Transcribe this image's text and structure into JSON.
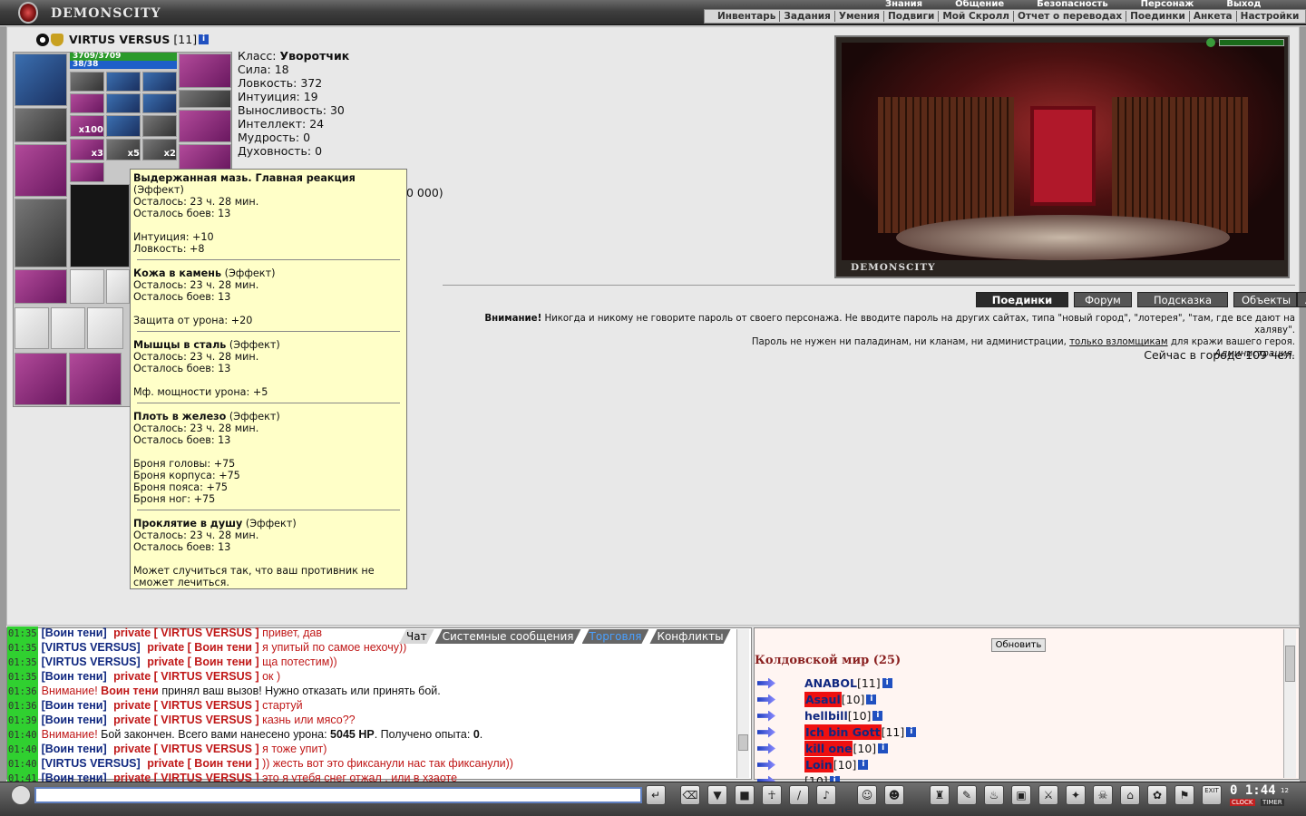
{
  "app": {
    "logo_text": "DEMONSCITY"
  },
  "main_menu": [
    "Знания",
    "Общение",
    "Безопасность",
    "Персонаж",
    "Выход"
  ],
  "sub_menu": [
    "Инвентарь",
    "Задания",
    "Умения",
    "Подвиги",
    "Мой Скролл",
    "Отчет о переводах",
    "Поединки",
    "Анкета",
    "Настройки"
  ],
  "character": {
    "name": "VIRTUS VERSUS",
    "level": "[11]",
    "hp": "3709/3709",
    "mp": "38/38",
    "hp_fraction": 1.0,
    "mp_fraction": 1.0
  },
  "stats": [
    {
      "label": "Класс:",
      "value": "Уворотчик",
      "bold": true
    },
    {
      "label": "Сила:",
      "value": "18"
    },
    {
      "label": "Ловкость:",
      "value": "372"
    },
    {
      "label": "Интуиция:",
      "value": "19"
    },
    {
      "label": "Выносливость:",
      "value": "30"
    },
    {
      "label": "Интеллект:",
      "value": "24"
    },
    {
      "label": "Мудрость:",
      "value": "0"
    },
    {
      "label": "Духовность:",
      "value": "0"
    }
  ],
  "partial_text": "0 000)",
  "slot_counts": {
    "a": "x100",
    "b": "x3",
    "c": "x5",
    "d": "x2"
  },
  "tooltip": {
    "effects": [
      {
        "title": "Выдержанная мазь. Главная реакция",
        "suffix": "",
        "type_line": "(Эффект)",
        "remain": "Осталось: 23 ч. 28 мин.",
        "fights": "Осталось боев: 13",
        "bonuses": [
          "Интуиция: +10",
          "Ловкость: +8"
        ]
      },
      {
        "title": "Кожа в камень",
        "suffix": " (Эффект)",
        "type_line": "",
        "remain": "Осталось: 23 ч. 28 мин.",
        "fights": "Осталось боев: 13",
        "bonuses": [
          "Защита от урона: +20"
        ]
      },
      {
        "title": "Мышцы в сталь",
        "suffix": " (Эффект)",
        "type_line": "",
        "remain": "Осталось: 23 ч. 28 мин.",
        "fights": "Осталось боев: 13",
        "bonuses": [
          "Мф. мощности урона: +5"
        ]
      },
      {
        "title": "Плоть в железо",
        "suffix": " (Эффект)",
        "type_line": "",
        "remain": "Осталось: 23 ч. 28 мин.",
        "fights": "Осталось боев: 13",
        "bonuses": [
          "Броня головы: +75",
          "Броня корпуса: +75",
          "Броня пояса: +75",
          "Броня ног: +75"
        ]
      },
      {
        "title": "Проклятие в душу",
        "suffix": " (Эффект)",
        "type_line": "",
        "remain": "Осталось: 23 ч. 28 мин.",
        "fights": "Осталось боев: 13",
        "bonuses": [
          "Может случиться так, что ваш противник не сможет лечиться."
        ]
      }
    ]
  },
  "location": {
    "title": "DEMONSCITY"
  },
  "tabs": [
    "Поединки",
    "Форум",
    "Подсказка",
    "Объекты",
    "Δ"
  ],
  "warning": {
    "bold": "Внимание!",
    "line1": " Никогда и никому не говорите пароль от своего персонажа. Не вводите пароль на других сайтах, типа \"новый город\", \"лотерея\", \"там, где все дают на халяву\".",
    "line2_pre": "Пароль не нужен ни паладинам, ни кланам, ни администрации, ",
    "line2_link": "только взломщикам",
    "line2_post": " для кражи вашего героя.",
    "signature": "Администрация."
  },
  "online": "Сейчас в городе 109 чел.",
  "chat_tabs": [
    "Чат",
    "Системные сообщения",
    "Торговля",
    "Конфликты"
  ],
  "chat": [
    {
      "time": "01:35",
      "from": "[Воин тени]",
      "priv": "private [ VIRTUS VERSUS ]",
      "msg": " привет, дав"
    },
    {
      "time": "01:35",
      "from": "[VIRTUS VERSUS]",
      "priv": "private [ Воин тени ]",
      "msg": " я упитый по самое нехочу))"
    },
    {
      "time": "01:35",
      "from": "[VIRTUS VERSUS]",
      "priv": "private [ Воин тени ]",
      "msg": " ща потестим))"
    },
    {
      "time": "01:35",
      "from": "[Воин тени]",
      "priv": "private [ VIRTUS VERSUS ]",
      "msg": " ок )"
    },
    {
      "time": "01:36",
      "sys": true,
      "parts": [
        "Внимание! ",
        "Воин тени",
        " принял ваш вызов! Нужно отказать или принять бой."
      ]
    },
    {
      "time": "01:36",
      "from": "[Воин тени]",
      "priv": "private [ VIRTUS VERSUS ]",
      "msg": " стартуй"
    },
    {
      "time": "01:39",
      "from": "[Воин тени]",
      "priv": "private [ VIRTUS VERSUS ]",
      "msg": " казнь или мясо??"
    },
    {
      "time": "01:40",
      "sys2": true,
      "parts": [
        "Внимание! ",
        "Бой закончен. Всего вами нанесено урона: ",
        "5045 HP",
        ". Получено опыта: ",
        "0",
        "."
      ]
    },
    {
      "time": "01:40",
      "from": "[Воин тени]",
      "priv": "private [ VIRTUS VERSUS ]",
      "msg": " я тоже упит)"
    },
    {
      "time": "01:40",
      "from": "[VIRTUS VERSUS]",
      "priv": "private [ Воин тени ]",
      "msg": " )) жесть вот это фиксанули нас так фиксанули))"
    },
    {
      "time": "01:41",
      "from": "[Воин тени]",
      "priv": "private [ VIRTUS VERSUS ]",
      "msg": " это я утебя снег отжал , или в хзаоте"
    }
  ],
  "player_list": {
    "refresh_label": "Обновить",
    "room": "Колдовской мир (25)",
    "players": [
      {
        "name": "ANABOL",
        "level": "[11]",
        "style": "nm"
      },
      {
        "name": "Asaul",
        "level": "[10]",
        "style": "red"
      },
      {
        "name": "hellbill",
        "level": "[10]",
        "style": "nm"
      },
      {
        "name": "Ich bin Gott",
        "level": "[11]",
        "style": "red"
      },
      {
        "name": "kill one",
        "level": "[10]",
        "style": "red"
      },
      {
        "name": "Loin",
        "level": "[10]",
        "style": "red"
      },
      {
        "name": "",
        "level": "[10]",
        "style": "grn"
      }
    ]
  },
  "clock": {
    "time": "0 1:44",
    "sec": "12",
    "label": "CLOCK",
    "label2": "TIMER",
    "exit": "EXIT"
  }
}
